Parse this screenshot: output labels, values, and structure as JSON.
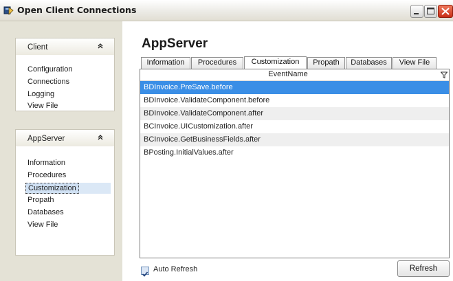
{
  "window": {
    "title": "Open Client Connections",
    "colors": {
      "selection": "#3a8ee6",
      "titlebar_close": "#c72d17"
    }
  },
  "sidebar": {
    "groups": [
      {
        "title": "Client",
        "expanded": true,
        "items": [
          {
            "label": "Configuration"
          },
          {
            "label": "Connections"
          },
          {
            "label": "Logging"
          },
          {
            "label": "View File"
          }
        ]
      },
      {
        "title": "AppServer",
        "expanded": true,
        "items": [
          {
            "label": "Information"
          },
          {
            "label": "Procedures"
          },
          {
            "label": "Customization",
            "selected": true
          },
          {
            "label": "Propath"
          },
          {
            "label": "Databases"
          },
          {
            "label": "View File"
          }
        ]
      }
    ]
  },
  "main": {
    "heading": "AppServer",
    "tabs": [
      {
        "label": "Information"
      },
      {
        "label": "Procedures"
      },
      {
        "label": "Customization",
        "active": true
      },
      {
        "label": "Propath"
      },
      {
        "label": "Databases"
      },
      {
        "label": "View File"
      }
    ],
    "grid": {
      "column": "EventName",
      "filter_icon": "filter-icon",
      "rows": [
        "BDInvoice.PreSave.before",
        "BDInvoice.ValidateComponent.before",
        "BDInvoice.ValidateComponent.after",
        "BCInvoice.UICustomization.after",
        "BCInvoice.GetBusinessFields.after",
        "BPosting.InitialValues.after"
      ],
      "selected_row": 0
    },
    "auto_refresh": {
      "label": "Auto Refresh",
      "checked": true
    },
    "refresh_button": "Refresh"
  }
}
